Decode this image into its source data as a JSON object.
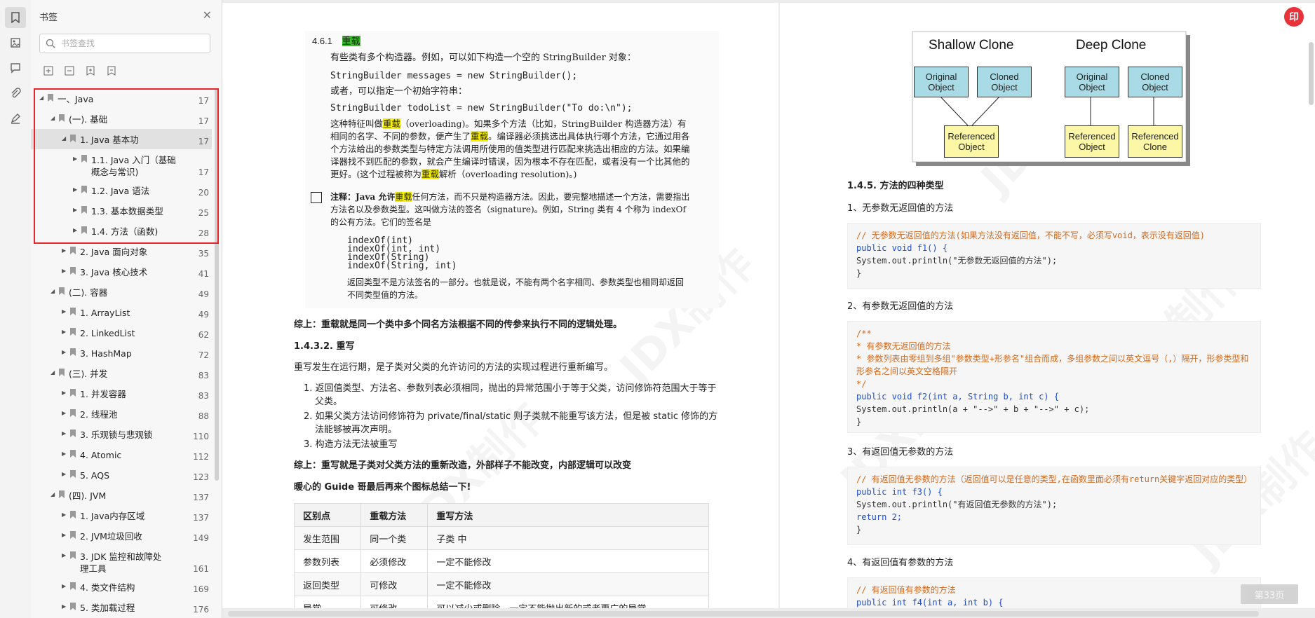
{
  "panel": {
    "title": "书签",
    "search_placeholder": "书签查找",
    "items": [
      {
        "label": "一、Java",
        "page": "17"
      },
      {
        "label": "(一). 基础",
        "page": "17"
      },
      {
        "label": "1. Java 基本功",
        "page": "17"
      },
      {
        "label": "1.1. Java 入门（基础概念与常识)",
        "page": "17"
      },
      {
        "label": "1.2. Java 语法",
        "page": "20"
      },
      {
        "label": "1.3. 基本数据类型",
        "page": "25"
      },
      {
        "label": "1.4. 方法（函数)",
        "page": "28"
      },
      {
        "label": "2. Java 面向对象",
        "page": "35"
      },
      {
        "label": "3. Java 核心技术",
        "page": "41"
      },
      {
        "label": "(二). 容器",
        "page": "49"
      },
      {
        "label": "1. ArrayList",
        "page": "49"
      },
      {
        "label": "2. LinkedList",
        "page": "62"
      },
      {
        "label": "3. HashMap",
        "page": "72"
      },
      {
        "label": "(三). 并发",
        "page": "83"
      },
      {
        "label": "1. 并发容器",
        "page": "83"
      },
      {
        "label": "2. 线程池",
        "page": "88"
      },
      {
        "label": "3. 乐观锁与悲观锁",
        "page": "110"
      },
      {
        "label": "4. Atomic",
        "page": "112"
      },
      {
        "label": "5. AQS",
        "page": "123"
      },
      {
        "label": "(四). JVM",
        "page": "137"
      },
      {
        "label": "1. Java内存区域",
        "page": "137"
      },
      {
        "label": "2. JVM垃圾回收",
        "page": "149"
      },
      {
        "label": "3. JDK 监控和故障处理工具",
        "page": "161"
      },
      {
        "label": "4. 类文件结构",
        "page": "169"
      },
      {
        "label": "5. 类加载过程",
        "page": "176"
      }
    ]
  },
  "left_page": {
    "scan_heading_num": "4.6.1",
    "scan_heading_word": "重载",
    "scan_p1": "有些类有多个构造器。例如，可以如下构造一个空的 StringBuilder 对象：",
    "scan_code1": "StringBuilder messages = new StringBuilder();",
    "scan_p2": "或者，可以指定一个初始字符串：",
    "scan_code2": "StringBuilder todoList = new StringBuilder(\"To do:\\n\");",
    "scan_p3a": "这种特征叫做",
    "scan_p3b": "重载",
    "scan_p3c": "（overloading)。如果多个方法（比如，StringBuilder 构造器方法）有相同的名字、不同的参数，便产生了",
    "scan_p3d": "重载",
    "scan_p3e": "。编译器必须挑选出具体执行哪个方法，它通过用各个方法给出的参数类型与特定方法调用所使用的值类型进行匹配来挑选出相应的方法。如果编译器找不到匹配的参数，就会产生编译时错误，因为根本不存在匹配，或者没有一个比其他的更好。(这个过程被称为",
    "scan_p3f": "重载",
    "scan_p3g": "解析（overloading resolution)。)",
    "scan_note_a": "注释：Java 允许",
    "scan_note_b": "重载",
    "scan_note_c": "任何方法，而不只是构造器方法。因此，要完整地描述一个方法，需要指出方法名以及参数类型。这叫做方法的签名（signature)。例如，String 类有 4 个称为 indexOf 的公有方法。它们的签名是",
    "scan_sigs": [
      "indexOf(int)",
      "indexOf(int, int)",
      "indexOf(String)",
      "indexOf(String, int)"
    ],
    "scan_p4": "返回类型不是方法签名的一部分。也就是说，不能有两个名字相同、参数类型也相同却返回不同类型值的方法。",
    "summary1": "综上：重载就是同一个类中多个同名方法根据不同的传参来执行不同的逻辑处理。",
    "h1432": "1.4.3.2. 重写",
    "rewrite_intro": "重写发生在运行期，是子类对父类的允许访问的方法的实现过程进行重新编写。",
    "rule1": "1. 返回值类型、方法名、参数列表必须相同，抛出的异常范围小于等于父类，访问修饰符范围大于等于父类。",
    "rule2": "2. 如果父类方法访问修饰符为 private/final/static 则子类就不能重写该方法，但是被 static 修饰的方法能够被再次声明。",
    "rule3": "3. 构造方法无法被重写",
    "summary2": "综上：重写就是子类对父类方法的重新改造，外部样子不能改变，内部逻辑可以改变",
    "guide": "暖心的 Guide 哥最后再来个图标总结一下!",
    "table_headers": [
      "区别点",
      "重载方法",
      "重写方法"
    ],
    "table_rows": [
      [
        "发生范围",
        "同一个类",
        "子类 中"
      ],
      [
        "参数列表",
        "必须修改",
        "一定不能修改"
      ],
      [
        "返回类型",
        "可修改",
        "一定不能修改"
      ],
      [
        "异常",
        "可修改",
        "可以减少或删除，一定不能抛出新的或者更广的异常"
      ]
    ]
  },
  "right_page": {
    "diagram": {
      "shallow_title": "Shallow Clone",
      "deep_title": "Deep Clone",
      "original": "Original Object",
      "cloned": "Cloned Object",
      "referenced": "Referenced Object",
      "ref_clone": "Referenced Clone"
    },
    "h145": "1.4.5. 方法的四种类型",
    "t1": "1、无参数无返回值的方法",
    "c1": [
      "// 无参数无返回值的方法(如果方法没有返回值，不能不写，必须写void，表示没有返回值)",
      "public void f1() {",
      "    System.out.println(\"无参数无返回值的方法\");",
      "}"
    ],
    "t2": "2、有参数无返回值的方法",
    "c2": [
      "/**",
      "* 有参数无返回值的方法",
      "* 参数列表由零组到多组\"参数类型+形参名\"组合而成，多组参数之间以英文逗号（,）隔开，形参类型和形参名之间以英文空格隔开",
      "*/",
      "public void f2(int a, String b, int c) {",
      "    System.out.println(a + \"-->\" + b + \"-->\" + c);",
      "}"
    ],
    "t3": "3、有返回值无参数的方法",
    "c3": [
      "// 有返回值无参数的方法（返回值可以是任意的类型,在函数里面必须有return关键字返回对应的类型）",
      "public int f3() {",
      "    System.out.println(\"有返回值无参数的方法\");",
      "    return 2;",
      "}"
    ],
    "t4": "4、有返回值有参数的方法",
    "c4": [
      "// 有返回值有参数的方法",
      "public int f4(int a, int b) {"
    ],
    "page_indicator": "第33页"
  },
  "watermark": "JDX制作",
  "avatar_text": "印",
  "colors": {
    "highlight_border": "#e8262a",
    "accent_red": "#e8323a"
  }
}
